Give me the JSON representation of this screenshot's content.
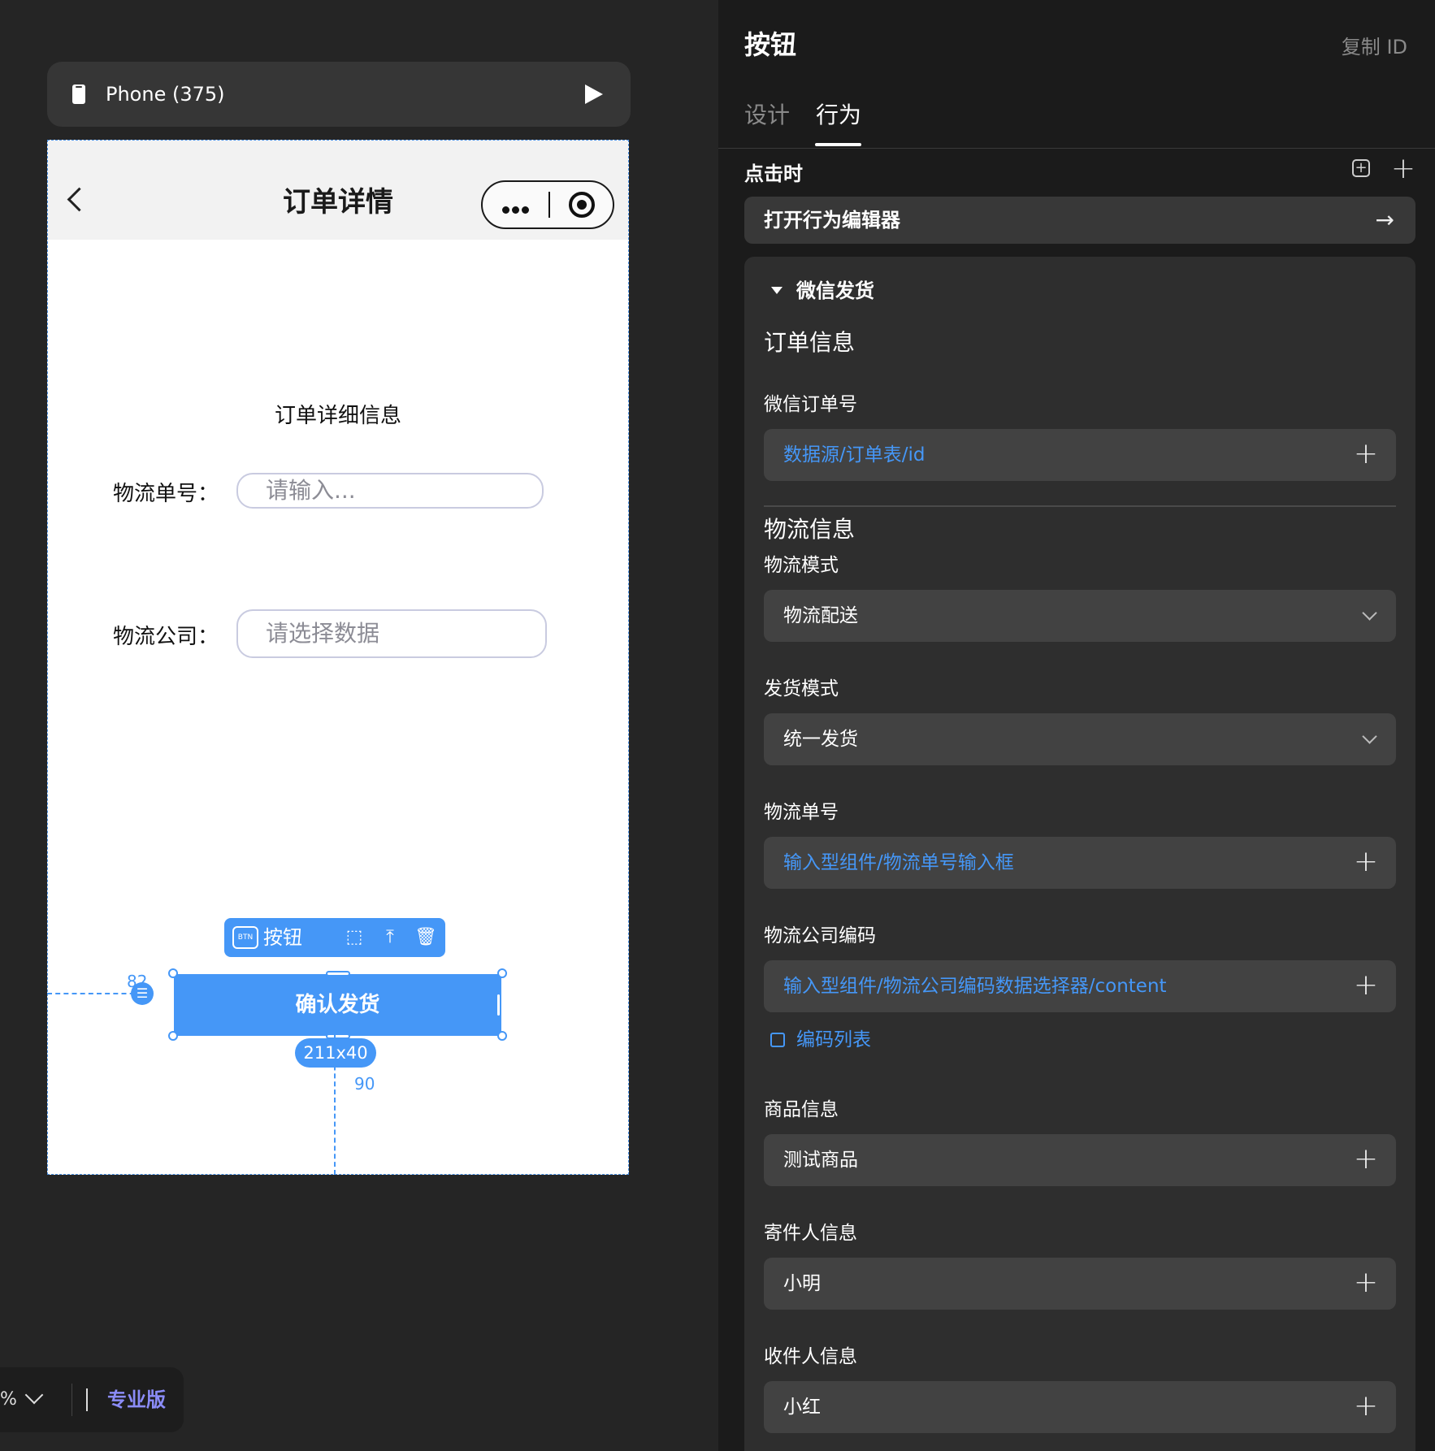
{
  "device_bar": {
    "label": "Phone (375)"
  },
  "phone": {
    "nav_title": "订单详情",
    "subtitle": "订单详细信息",
    "tracking_label": "物流单号：",
    "tracking_placeholder": "请输入...",
    "company_label": "物流公司：",
    "company_placeholder": "请选择数据",
    "confirm_button": "确认发货"
  },
  "selection": {
    "toolbar_icon_text": "BTN",
    "toolbar_name": "按钮",
    "left_distance": "82",
    "bottom_distance": "90",
    "size_badge": "211x40"
  },
  "zoom_bar": {
    "zoom_text": "%",
    "edition": "专业版"
  },
  "panel": {
    "title": "按钮",
    "copy_id": "复制 ID",
    "tabs": [
      {
        "label": "设计"
      },
      {
        "label": "行为"
      }
    ],
    "active_tab": "行为",
    "on_click_label": "点击时",
    "open_editor": "打开行为编辑器",
    "action": {
      "name": "微信发货",
      "order_section": "订单信息",
      "wechat_order_label": "微信订单号",
      "wechat_order_value": "数据源/订单表/id",
      "logistics_section": "物流信息",
      "logistics_mode_label": "物流模式",
      "logistics_mode_value": "物流配送",
      "delivery_mode_label": "发货模式",
      "delivery_mode_value": "统一发货",
      "tracking_label": "物流单号",
      "tracking_value": "输入型组件/物流单号输入框",
      "company_code_label": "物流公司编码",
      "company_code_value": "输入型组件/物流公司编码数据选择器/content",
      "code_list_link": "编码列表",
      "goods_label": "商品信息",
      "goods_value": "测试商品",
      "sender_label": "寄件人信息",
      "sender_value": "小明",
      "receiver_label": "收件人信息",
      "receiver_value": "小红"
    }
  },
  "colors": {
    "accent": "#4597f7",
    "panel_bg": "#1b1b1b",
    "card_bg": "#2e2e2e",
    "pro": "#8b8cf8"
  }
}
